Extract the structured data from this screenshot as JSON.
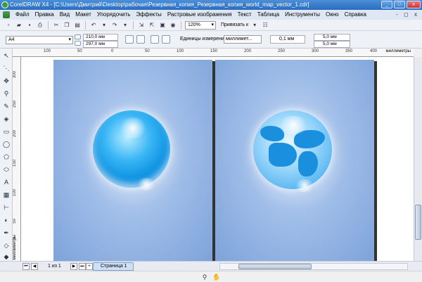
{
  "window": {
    "title": "CorelDRAW X4 - [C:\\Users\\Дмитрий\\Desktop\\рабочая\\Резервная_копия_Резервная_копия_world_map_vector_1.cdr]",
    "buttons": {
      "minimize": "_",
      "maximize": "□",
      "close": "x"
    }
  },
  "menu": {
    "items": [
      "Файл",
      "Правка",
      "Вид",
      "Макет",
      "Упорядочить",
      "Эффекты",
      "Растровые изображения",
      "Текст",
      "Таблица",
      "Инструменты",
      "Окно",
      "Справка"
    ],
    "doc_controls": "- ◻ x"
  },
  "toolbar": {
    "zoom": "120%",
    "snap_label": "Привязать к"
  },
  "property_bar": {
    "paper": "A4",
    "width": "210,0 мм",
    "height": "297,0 мм",
    "units_label": "Единицы измерения:",
    "units_value": "миллимет...",
    "nudge": "0,1 мм",
    "dup_x": "5,0 мм",
    "dup_y": "5,0 мм"
  },
  "ruler": {
    "h_ticks": [
      "100",
      "50",
      "0",
      "50",
      "100",
      "150",
      "200",
      "250",
      "300",
      "350",
      "400"
    ],
    "h_unit": "миллиметры",
    "v_ticks": [
      "300",
      "250",
      "200",
      "150",
      "100",
      "50",
      "0"
    ],
    "v_unit": "миллиметры"
  },
  "pages": {
    "count_label": "1 из 1",
    "tab_label": "Страница 1"
  },
  "palette": {
    "colors": [
      "#ffffff",
      "#000000",
      "#8080ff",
      "#404080",
      "#00ff00",
      "#00a000",
      "#00ffff",
      "#0080ff",
      "#0000ff",
      "#ff00ff",
      "#ff0080",
      "#ff0000",
      "#ff8000",
      "#ffff00",
      "#c0c0ff",
      "#a0a0d0",
      "#8080c0",
      "#a0a0a0"
    ]
  }
}
